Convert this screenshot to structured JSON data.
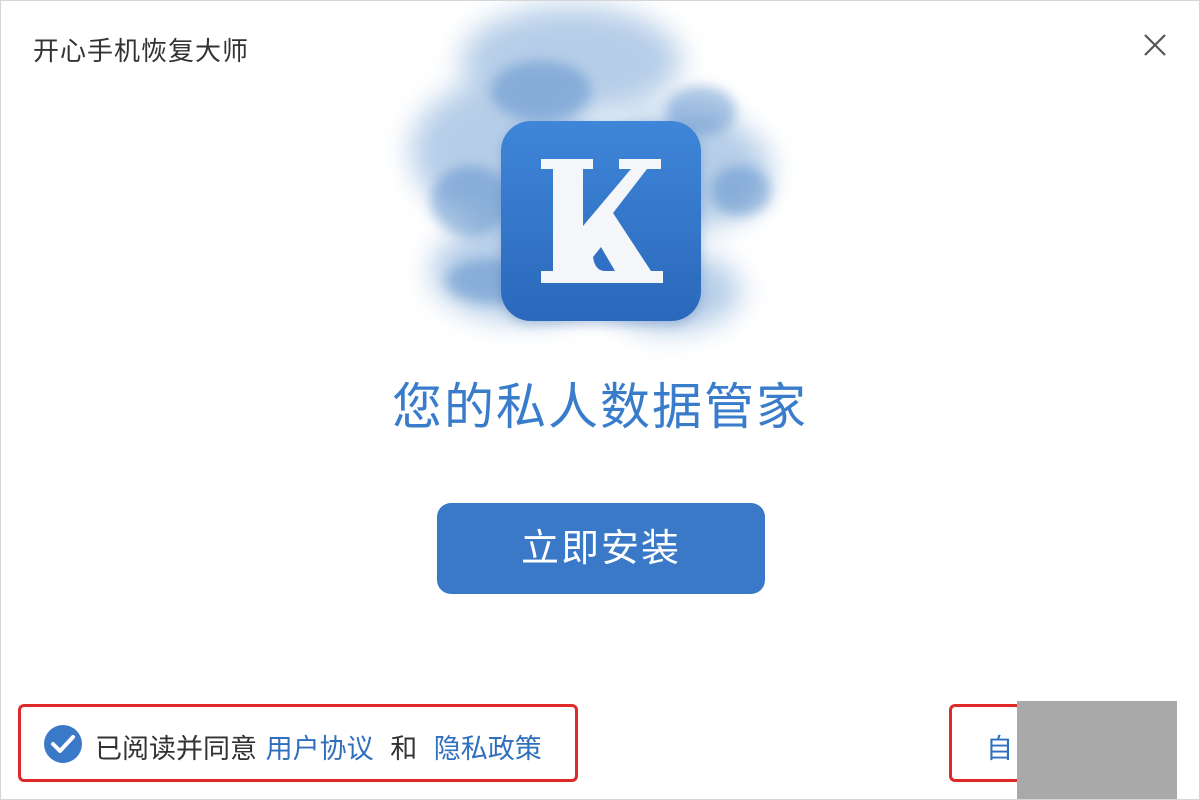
{
  "window": {
    "title": "开心手机恢复大师"
  },
  "hero": {
    "logo_letter": "K",
    "slogan": "您的私人数据管家"
  },
  "actions": {
    "install_label": "立即安装"
  },
  "agreement": {
    "checked": true,
    "prefix": "已阅读并同意",
    "user_agreement_link": "用户协议",
    "conjunction": "和",
    "privacy_policy_link": "隐私政策"
  },
  "custom_install": {
    "label": "自"
  },
  "colors": {
    "accent": "#3a79c8",
    "slogan": "#3a7ccc",
    "link": "#2f6fbe",
    "highlight_border": "#e02a2a"
  },
  "icons": {
    "close": "close-icon",
    "check": "check-circle-icon",
    "logo": "app-logo-icon"
  }
}
